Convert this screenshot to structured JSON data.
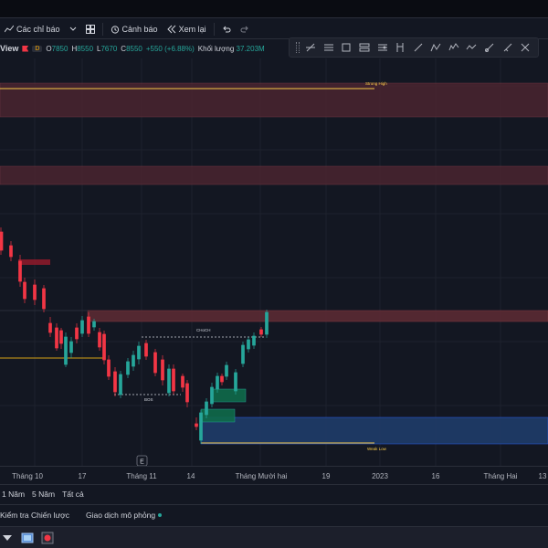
{
  "toolbar": {
    "indicators_label": "Các chỉ báo",
    "alerts_label": "Cảnh báo",
    "replay_label": "Xem lại"
  },
  "legend": {
    "symbol": "View",
    "interval_badge": "D",
    "open_key": "O",
    "open_val": "7850",
    "high_key": "H",
    "high_val": "8550",
    "low_key": "L",
    "low_val": "7670",
    "close_key": "C",
    "close_val": "8550",
    "change": "+550 (+6.88%)",
    "volume_key": "Khối lượng",
    "volume_val": "37.203M"
  },
  "colors": {
    "up": "#26a69a",
    "down": "#f23645",
    "bg": "#131722",
    "zone_red": "#5a2a33",
    "zone_blue": "#1e3a66"
  },
  "chart_labels": {
    "strong_high": "Strong High",
    "choch": "CHoCH",
    "bos": "BOS",
    "weak_low": "Weak Low",
    "event_marker": "E"
  },
  "time_axis": [
    "Tháng 10",
    "17",
    "Tháng 11",
    "14",
    "Tháng Mười hai",
    "19",
    "2023",
    "16",
    "Tháng Hai",
    "13"
  ],
  "ranges": [
    "1 Năm",
    "5 Năm",
    "Tất cả"
  ],
  "bottom_panel": {
    "strategy_tester": "Kiểm tra Chiến lược",
    "paper_trading": "Giao dịch mô phỏng"
  }
}
